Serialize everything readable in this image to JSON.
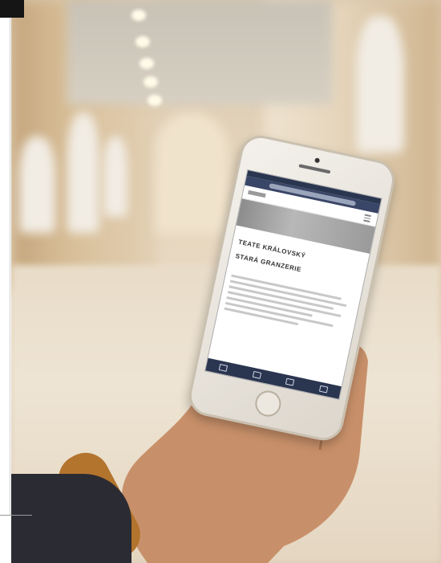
{
  "photo": {
    "description_icons": [
      "smartphone-icon",
      "hand-icon"
    ],
    "colors": {
      "gallery_wall": "#d8bf99",
      "floor": "#eee4d3",
      "phone_body": "#f4f1ec",
      "browser_bar": "#2a3550",
      "sleeve_cuff": "#b3742d"
    }
  },
  "phone_screen": {
    "title_line_1": "TEATE KRÁLOVSKÝ",
    "title_line_2": "STARÁ GRANZERIE"
  }
}
